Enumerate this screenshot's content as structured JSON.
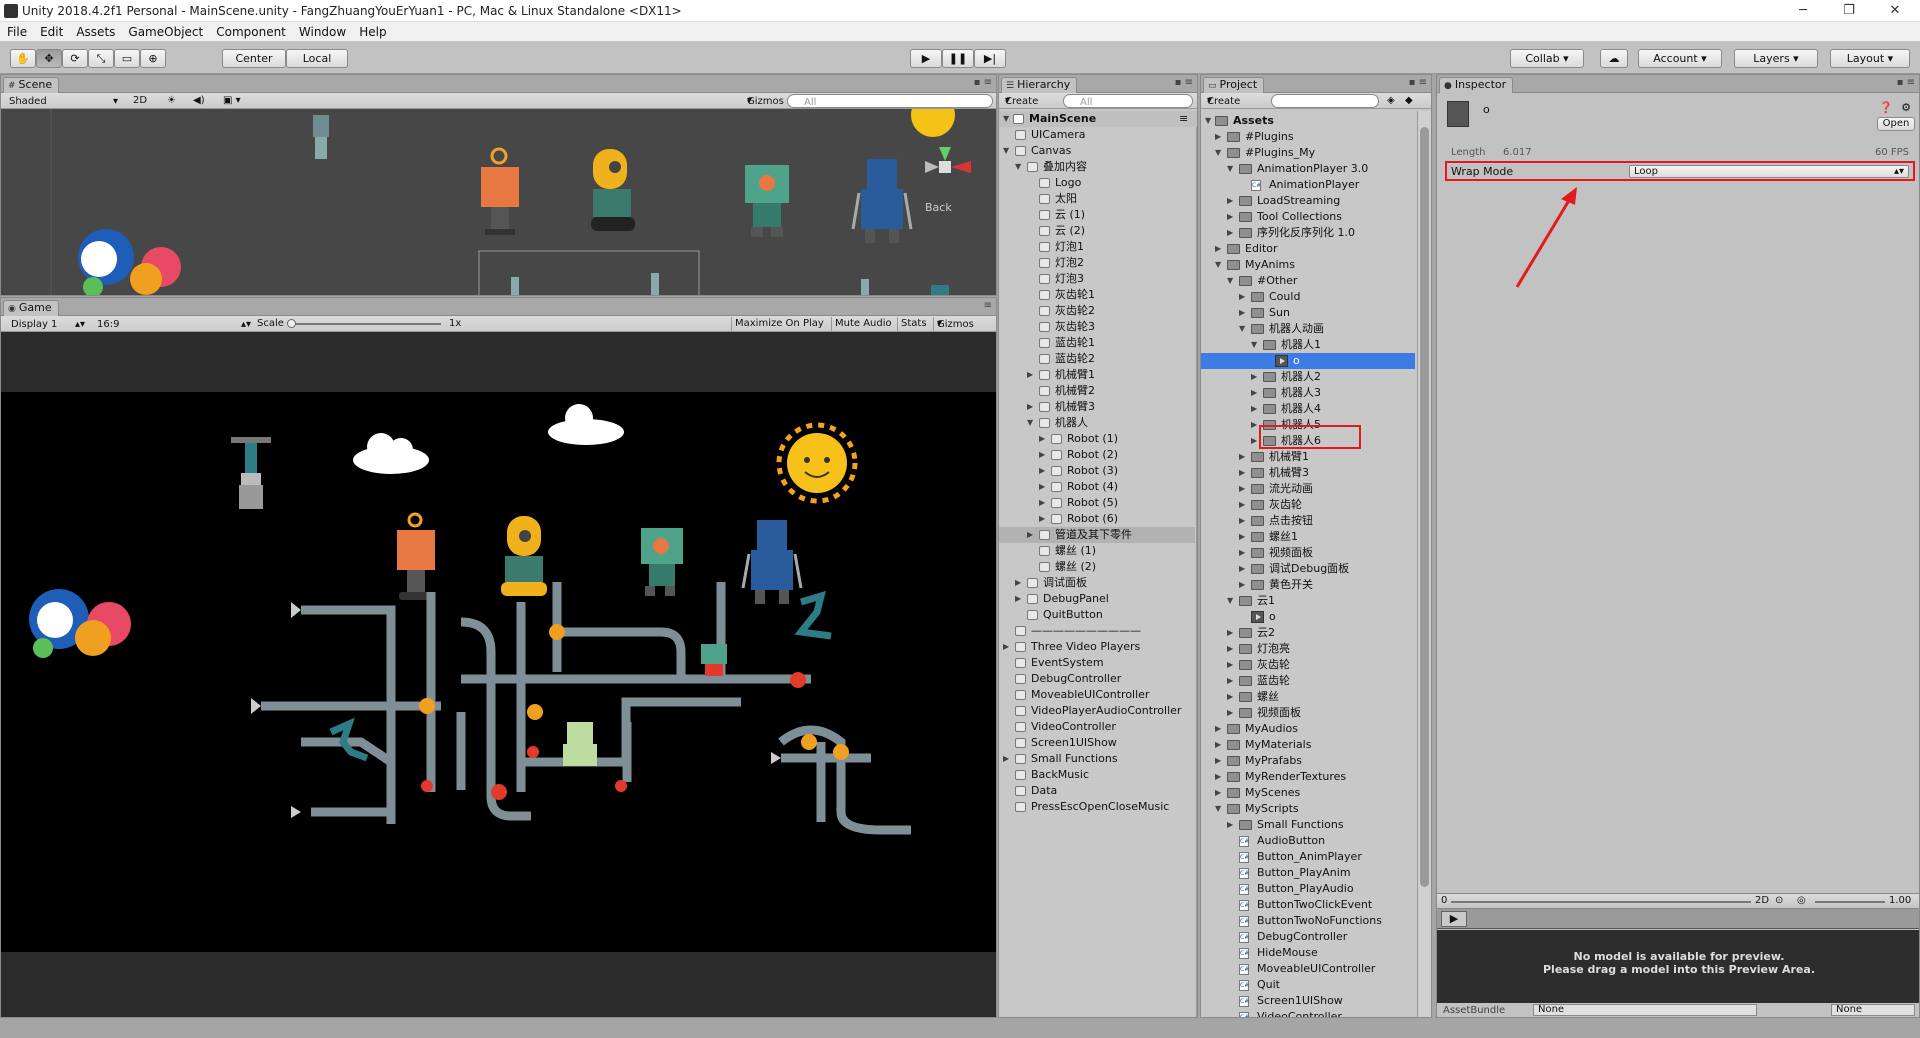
{
  "window": {
    "title": "Unity 2018.4.2f1 Personal - MainScene.unity - FangZhuangYouErYuan1 - PC, Mac & Linux Standalone <DX11>",
    "min": "─",
    "max": "❐",
    "close": "✕"
  },
  "menu": [
    "File",
    "Edit",
    "Assets",
    "GameObject",
    "Component",
    "Window",
    "Help"
  ],
  "toolbar": {
    "center": "Center",
    "local": "Local",
    "collab": "Collab",
    "account": "Account",
    "layers": "Layers",
    "layout": "Layout"
  },
  "scene": {
    "tab": "Scene",
    "shaded": "Shaded",
    "mode2d": "2D",
    "gizmos": "Gizmos",
    "search": "All",
    "back": "Back"
  },
  "game": {
    "tab": "Game",
    "display": "Display 1",
    "aspect": "16:9",
    "scale": "Scale",
    "scale_val": "1x",
    "max_on_play": "Maximize On Play",
    "mute": "Mute Audio",
    "stats": "Stats",
    "gizmos": "Gizmos",
    "scale_fraction": 0.0
  },
  "hierarchy": {
    "tab": "Hierarchy",
    "create": "Create",
    "search": "All",
    "root": "MainScene",
    "items": [
      {
        "t": "UICamera",
        "d": 1,
        "a": ""
      },
      {
        "t": "Canvas",
        "d": 1,
        "a": "down"
      },
      {
        "t": "叠加内容",
        "d": 2,
        "a": "down"
      },
      {
        "t": "Logo",
        "d": 3,
        "a": ""
      },
      {
        "t": "太阳",
        "d": 3,
        "a": ""
      },
      {
        "t": "云 (1)",
        "d": 3,
        "a": ""
      },
      {
        "t": "云 (2)",
        "d": 3,
        "a": ""
      },
      {
        "t": "灯泡1",
        "d": 3,
        "a": ""
      },
      {
        "t": "灯泡2",
        "d": 3,
        "a": ""
      },
      {
        "t": "灯泡3",
        "d": 3,
        "a": ""
      },
      {
        "t": "灰齿轮1",
        "d": 3,
        "a": ""
      },
      {
        "t": "灰齿轮2",
        "d": 3,
        "a": ""
      },
      {
        "t": "灰齿轮3",
        "d": 3,
        "a": ""
      },
      {
        "t": "蓝齿轮1",
        "d": 3,
        "a": ""
      },
      {
        "t": "蓝齿轮2",
        "d": 3,
        "a": ""
      },
      {
        "t": "机械臂1",
        "d": 3,
        "a": "right"
      },
      {
        "t": "机械臂2",
        "d": 3,
        "a": ""
      },
      {
        "t": "机械臂3",
        "d": 3,
        "a": "right"
      },
      {
        "t": "机器人",
        "d": 3,
        "a": "down"
      },
      {
        "t": "Robot (1)",
        "d": 4,
        "a": "right"
      },
      {
        "t": "Robot (2)",
        "d": 4,
        "a": "right"
      },
      {
        "t": "Robot (3)",
        "d": 4,
        "a": "right"
      },
      {
        "t": "Robot (4)",
        "d": 4,
        "a": "right"
      },
      {
        "t": "Robot (5)",
        "d": 4,
        "a": "right"
      },
      {
        "t": "Robot (6)",
        "d": 4,
        "a": "right"
      },
      {
        "t": "管道及其下零件",
        "d": 3,
        "a": "right",
        "hl": true
      },
      {
        "t": "螺丝 (1)",
        "d": 3,
        "a": ""
      },
      {
        "t": "螺丝 (2)",
        "d": 3,
        "a": ""
      },
      {
        "t": "调试面板",
        "d": 2,
        "a": "right"
      },
      {
        "t": "DebugPanel",
        "d": 2,
        "a": "right"
      },
      {
        "t": "QuitButton",
        "d": 2,
        "a": ""
      },
      {
        "t": "——————————",
        "d": 1,
        "a": ""
      },
      {
        "t": "Three Video Players",
        "d": 1,
        "a": "right"
      },
      {
        "t": "EventSystem",
        "d": 1,
        "a": ""
      },
      {
        "t": "DebugController",
        "d": 1,
        "a": ""
      },
      {
        "t": "MoveableUIController",
        "d": 1,
        "a": ""
      },
      {
        "t": "VideoPlayerAudioController",
        "d": 1,
        "a": ""
      },
      {
        "t": "VideoController",
        "d": 1,
        "a": ""
      },
      {
        "t": "Screen1UIShow",
        "d": 1,
        "a": ""
      },
      {
        "t": "Small Functions",
        "d": 1,
        "a": "right"
      },
      {
        "t": "BackMusic",
        "d": 1,
        "a": ""
      },
      {
        "t": "Data",
        "d": 1,
        "a": ""
      },
      {
        "t": "PressEscOpenCloseMusic",
        "d": 1,
        "a": ""
      }
    ]
  },
  "project": {
    "tab": "Project",
    "create": "Create",
    "root": "Assets",
    "items": [
      {
        "t": "#Plugins",
        "d": 1,
        "a": "right",
        "k": "folder"
      },
      {
        "t": "#Plugins_My",
        "d": 1,
        "a": "down",
        "k": "folder"
      },
      {
        "t": "AnimationPlayer 3.0",
        "d": 2,
        "a": "down",
        "k": "folder"
      },
      {
        "t": "AnimationPlayer",
        "d": 3,
        "a": "",
        "k": "script"
      },
      {
        "t": "LoadStreaming",
        "d": 2,
        "a": "right",
        "k": "folder"
      },
      {
        "t": "Tool Collections",
        "d": 2,
        "a": "right",
        "k": "folder"
      },
      {
        "t": "序列化反序列化 1.0",
        "d": 2,
        "a": "right",
        "k": "folder"
      },
      {
        "t": "Editor",
        "d": 1,
        "a": "right",
        "k": "folder"
      },
      {
        "t": "MyAnims",
        "d": 1,
        "a": "down",
        "k": "folder"
      },
      {
        "t": "#Other",
        "d": 2,
        "a": "down",
        "k": "folder"
      },
      {
        "t": "Could",
        "d": 3,
        "a": "right",
        "k": "folder"
      },
      {
        "t": "Sun",
        "d": 3,
        "a": "right",
        "k": "folder"
      },
      {
        "t": "机器人动画",
        "d": 3,
        "a": "down",
        "k": "folder"
      },
      {
        "t": "机器人1",
        "d": 4,
        "a": "down",
        "k": "folder"
      },
      {
        "t": "o",
        "d": 5,
        "a": "",
        "k": "anim",
        "sel": true
      },
      {
        "t": "机器人2",
        "d": 4,
        "a": "right",
        "k": "folder"
      },
      {
        "t": "机器人3",
        "d": 4,
        "a": "right",
        "k": "folder"
      },
      {
        "t": "机器人4",
        "d": 4,
        "a": "right",
        "k": "folder"
      },
      {
        "t": "机器人5",
        "d": 4,
        "a": "right",
        "k": "folder"
      },
      {
        "t": "机器人6",
        "d": 4,
        "a": "right",
        "k": "folder"
      },
      {
        "t": "机械臂1",
        "d": 3,
        "a": "right",
        "k": "folder"
      },
      {
        "t": "机械臂3",
        "d": 3,
        "a": "right",
        "k": "folder"
      },
      {
        "t": "流光动画",
        "d": 3,
        "a": "right",
        "k": "folder"
      },
      {
        "t": "灰齿轮",
        "d": 3,
        "a": "right",
        "k": "folder"
      },
      {
        "t": "点击按钮",
        "d": 3,
        "a": "right",
        "k": "folder"
      },
      {
        "t": "螺丝1",
        "d": 3,
        "a": "right",
        "k": "folder"
      },
      {
        "t": "视频面板",
        "d": 3,
        "a": "right",
        "k": "folder"
      },
      {
        "t": "调试Debug面板",
        "d": 3,
        "a": "right",
        "k": "folder"
      },
      {
        "t": "黄色开关",
        "d": 3,
        "a": "right",
        "k": "folder"
      },
      {
        "t": "云1",
        "d": 2,
        "a": "down",
        "k": "folder"
      },
      {
        "t": "o",
        "d": 3,
        "a": "",
        "k": "anim"
      },
      {
        "t": "云2",
        "d": 2,
        "a": "right",
        "k": "folder"
      },
      {
        "t": "灯泡亮",
        "d": 2,
        "a": "right",
        "k": "folder"
      },
      {
        "t": "灰齿轮",
        "d": 2,
        "a": "right",
        "k": "folder"
      },
      {
        "t": "蓝齿轮",
        "d": 2,
        "a": "right",
        "k": "folder"
      },
      {
        "t": "螺丝",
        "d": 2,
        "a": "right",
        "k": "folder"
      },
      {
        "t": "视频面板",
        "d": 2,
        "a": "right",
        "k": "folder"
      },
      {
        "t": "MyAudios",
        "d": 1,
        "a": "right",
        "k": "folder"
      },
      {
        "t": "MyMaterials",
        "d": 1,
        "a": "right",
        "k": "folder"
      },
      {
        "t": "MyPrafabs",
        "d": 1,
        "a": "right",
        "k": "folder"
      },
      {
        "t": "MyRenderTextures",
        "d": 1,
        "a": "right",
        "k": "folder"
      },
      {
        "t": "MyScenes",
        "d": 1,
        "a": "right",
        "k": "folder"
      },
      {
        "t": "MyScripts",
        "d": 1,
        "a": "down",
        "k": "folder"
      },
      {
        "t": "Small Functions",
        "d": 2,
        "a": "right",
        "k": "folder"
      },
      {
        "t": "AudioButton",
        "d": 2,
        "a": "",
        "k": "script"
      },
      {
        "t": "Button_AnimPlayer",
        "d": 2,
        "a": "",
        "k": "script"
      },
      {
        "t": "Button_PlayAnim",
        "d": 2,
        "a": "",
        "k": "script"
      },
      {
        "t": "Button_PlayAudio",
        "d": 2,
        "a": "",
        "k": "script"
      },
      {
        "t": "ButtonTwoClickEvent",
        "d": 2,
        "a": "",
        "k": "script"
      },
      {
        "t": "ButtonTwoNoFunctions",
        "d": 2,
        "a": "",
        "k": "script"
      },
      {
        "t": "DebugController",
        "d": 2,
        "a": "",
        "k": "script"
      },
      {
        "t": "HideMouse",
        "d": 2,
        "a": "",
        "k": "script"
      },
      {
        "t": "MoveableUIController",
        "d": 2,
        "a": "",
        "k": "script"
      },
      {
        "t": "Quit",
        "d": 2,
        "a": "",
        "k": "script"
      },
      {
        "t": "Screen1UIShow",
        "d": 2,
        "a": "",
        "k": "script"
      },
      {
        "t": "VideoController",
        "d": 2,
        "a": "",
        "k": "script"
      }
    ]
  },
  "inspector": {
    "tab": "Inspector",
    "asset_name": "o",
    "open": "Open",
    "length_label": "Length",
    "length_val": "6.017",
    "fps": "60 FPS",
    "wrap_label": "Wrap Mode",
    "wrap_val": "Loop",
    "preview_2d": "2D",
    "preview_speed": "1.00",
    "preview_time": "0",
    "no_model_1": "No model is available for preview.",
    "no_model_2": "Please drag a model into this Preview Area.",
    "assetbundle": "AssetBundle",
    "ab_none1": "None",
    "ab_none2": "None"
  }
}
